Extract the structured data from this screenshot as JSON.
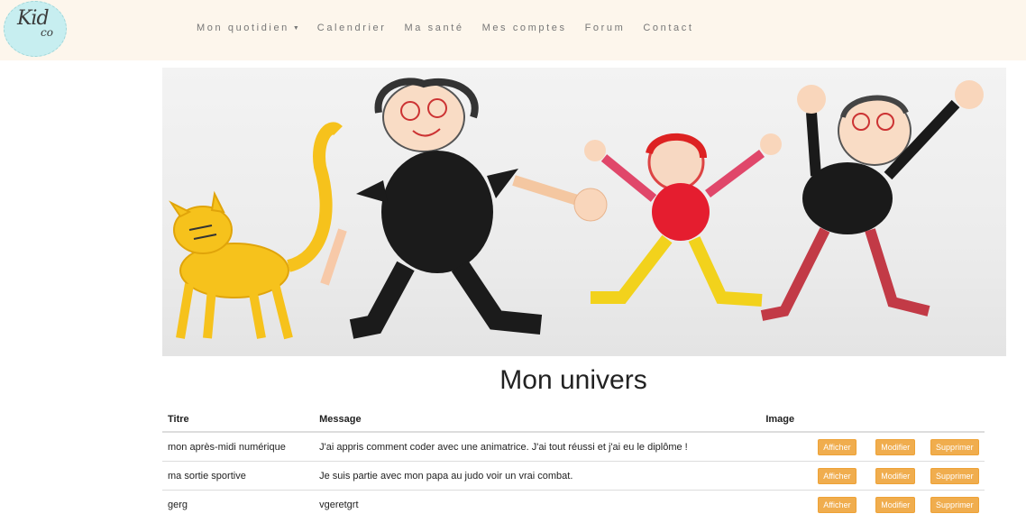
{
  "brand": {
    "logo_text": "Kid",
    "logo_sub": "co"
  },
  "nav": {
    "items": [
      {
        "label": "Mon quotidien",
        "has_dropdown": true
      },
      {
        "label": "Calendrier"
      },
      {
        "label": "Ma santé"
      },
      {
        "label": "Mes comptes"
      },
      {
        "label": "Forum"
      },
      {
        "label": "Contact"
      }
    ]
  },
  "page": {
    "title": "Mon univers"
  },
  "table": {
    "headers": {
      "title": "Titre",
      "message": "Message",
      "image": "Image"
    },
    "rows": [
      {
        "title": "mon après-midi numérique",
        "message": "J'ai appris comment coder avec une animatrice. J'ai tout réussi et j'ai eu le diplôme !",
        "image": ""
      },
      {
        "title": "ma sortie sportive",
        "message": "Je suis partie avec mon papa au judo voir un vrai combat.",
        "image": ""
      },
      {
        "title": "gerg",
        "message": "vgeretgrt",
        "image": ""
      }
    ],
    "actions": {
      "show": "Afficher",
      "edit": "Modifier",
      "delete": "Supprimer"
    }
  },
  "colors": {
    "navbar_bg": "#fdf6ec",
    "button_bg": "#f0ad4e",
    "logo_bg": "#c7eef0"
  }
}
